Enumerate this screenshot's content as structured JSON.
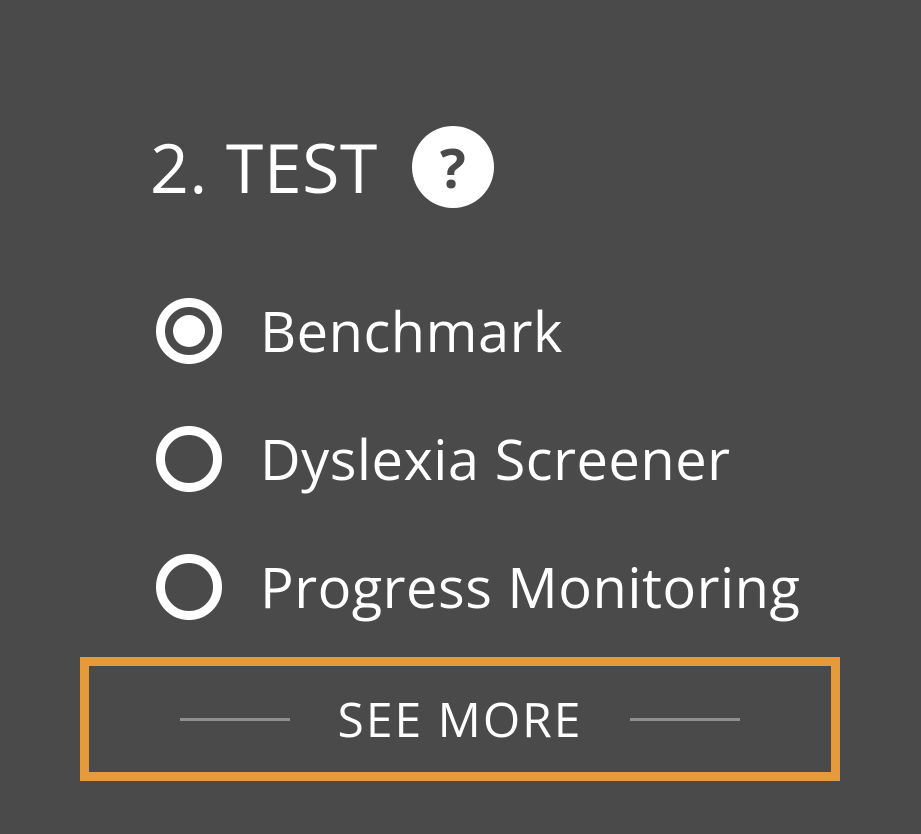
{
  "section": {
    "heading": "2. TEST",
    "help_symbol": "?"
  },
  "options": [
    {
      "label": "Benchmark",
      "selected": true
    },
    {
      "label": "Dyslexia Screener",
      "selected": false
    },
    {
      "label": "Progress Monitoring",
      "selected": false
    }
  ],
  "see_more": {
    "label": "SEE MORE"
  },
  "colors": {
    "background": "#4a4a4a",
    "accent_orange": "#e59a3b",
    "radio_white": "#ffffff",
    "line_gray": "#8f8f8f"
  }
}
